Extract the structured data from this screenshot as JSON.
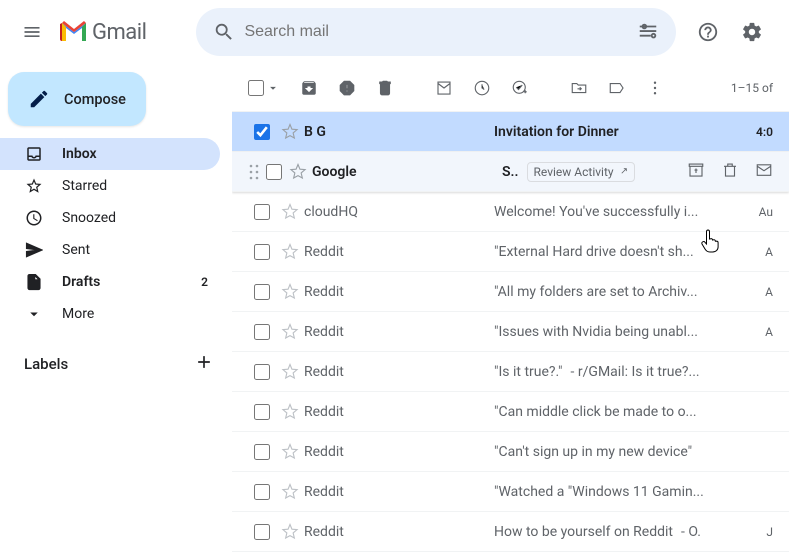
{
  "header": {
    "logo_text": "Gmail",
    "search_placeholder": "Search mail"
  },
  "compose_label": "Compose",
  "sidebar": {
    "items": [
      {
        "label": "Inbox",
        "count": ""
      },
      {
        "label": "Starred",
        "count": ""
      },
      {
        "label": "Snoozed",
        "count": ""
      },
      {
        "label": "Sent",
        "count": ""
      },
      {
        "label": "Drafts",
        "count": "2"
      },
      {
        "label": "More",
        "count": ""
      }
    ],
    "labels_heading": "Labels"
  },
  "toolbar": {
    "count_text": "1–15 of "
  },
  "hover_chip": "Review Activity",
  "emails": [
    {
      "sender": "B G",
      "subject": "Invitation for Dinner",
      "preview": "",
      "date": "4:0",
      "unread": true
    },
    {
      "sender": "Google",
      "subject": "S..",
      "preview": "",
      "date": "",
      "unread": true
    },
    {
      "sender": "cloudHQ",
      "subject": "Welcome! You've successfully i...",
      "preview": "",
      "date": "Au",
      "unread": false
    },
    {
      "sender": "Reddit",
      "subject": "\"External Hard drive doesn't sh...",
      "preview": "",
      "date": "A",
      "unread": false
    },
    {
      "sender": "Reddit",
      "subject": "\"All my folders are set to Archiv...",
      "preview": "",
      "date": "A",
      "unread": false
    },
    {
      "sender": "Reddit",
      "subject": "\"Issues with Nvidia being unabl...",
      "preview": "",
      "date": "A",
      "unread": false
    },
    {
      "sender": "Reddit",
      "subject": "\"Is it true?.\"",
      "preview": " - r/GMail: Is it true?...",
      "date": "",
      "unread": false
    },
    {
      "sender": "Reddit",
      "subject": "\"Can middle click be made to o...",
      "preview": "",
      "date": "",
      "unread": false
    },
    {
      "sender": "Reddit",
      "subject": "\"Can't sign up in my new device\"",
      "preview": "",
      "date": "",
      "unread": false
    },
    {
      "sender": "Reddit",
      "subject": "\"Watched a \"Windows 11 Gamin...",
      "preview": "",
      "date": "",
      "unread": false
    },
    {
      "sender": "Reddit",
      "subject": "How to be yourself on Reddit",
      "preview": " - O.",
      "date": "J",
      "unread": false
    }
  ]
}
